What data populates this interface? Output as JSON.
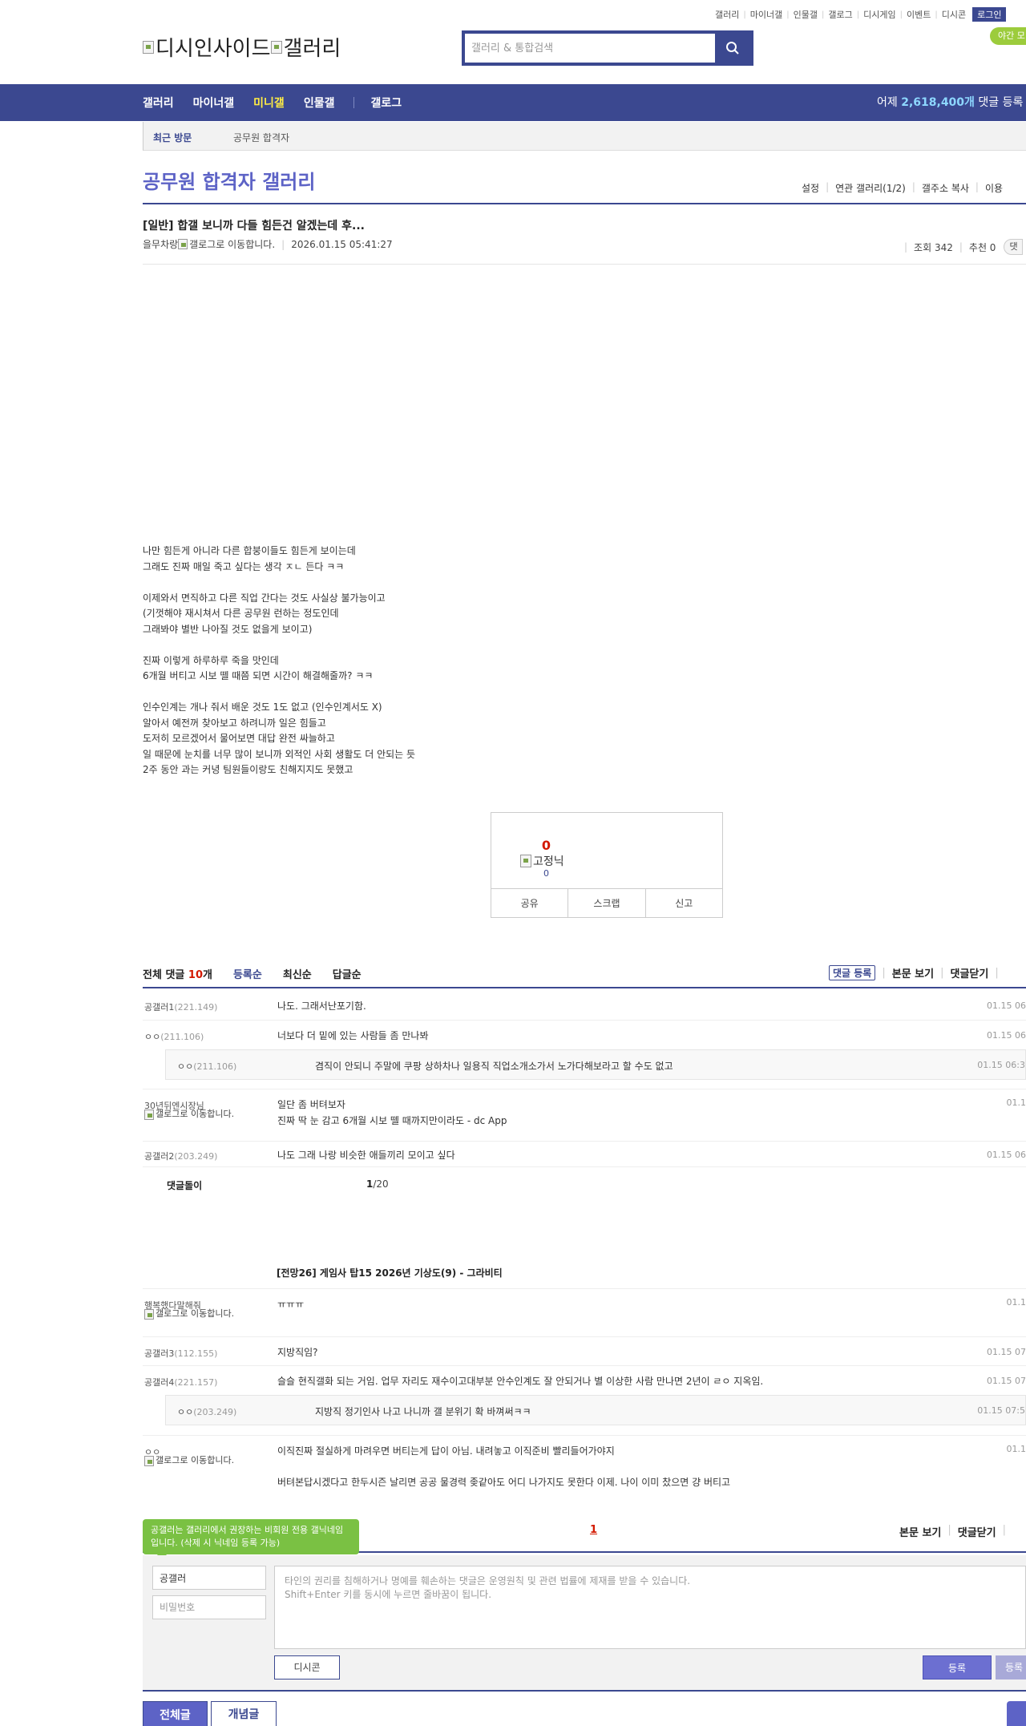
{
  "util_links": [
    "갤러리",
    "마이너갤",
    "인물갤",
    "갤로그",
    "디시게임",
    "이벤트",
    "디시콘"
  ],
  "login_label": "로그인",
  "night_mode_label": "야간 모",
  "logo": {
    "site_alt": "디시인사이드",
    "gallery_alt": "갤러리"
  },
  "search": {
    "placeholder": "갤러리 & 통합검색"
  },
  "gnb": {
    "items": [
      "갤러리",
      "마이너갤",
      "미니갤",
      "인물갤",
      "갤로그"
    ],
    "active_index": 2,
    "stat_prefix": "어제 ",
    "stat_count": "2,618,400개",
    "stat_suffix": " 댓글 등록"
  },
  "recent": {
    "label": "최근 방문",
    "item": "공무원 합격자"
  },
  "gallery": {
    "title": "공무원 합격자 갤러리",
    "tools": [
      "설정",
      "연관 갤러리(1/2)",
      "갤주소 복사",
      "이용"
    ]
  },
  "post": {
    "title": "[일반] 합갤 보니까 다들 힘든건 알겠는데 후...",
    "writer": "을무차랑",
    "gallog_alt": "갤로그로 이동합니다.",
    "date": "2026.01.15 05:41:27",
    "views": "조회 342",
    "recommend": "추천 0",
    "comments_pill": "댓",
    "body": [
      [
        "나만 힘든게 아니라 다른 합붕이들도 힘든게 보이는데",
        "그래도 진짜 매일 죽고 싶다는 생각 ㅈㄴ 든다 ㅋㅋ"
      ],
      [
        "이제와서 면직하고 다른 직업 간다는 것도 사실상 불가능이고",
        "(기껏해야 재시쳐서 다른 공무원 런하는 정도인데",
        "그래봐야 별반 나아질 것도 없을게 보이고)"
      ],
      [
        "진짜 이렇게 하루하루 죽을 맛인데",
        "6개월 버티고 시보 뗄 때쯤 되면 시간이 해결해줄까? ㅋㅋ"
      ],
      [
        "인수인계는 개나 줘서 배운 것도 1도 없고 (인수인계서도 X)",
        "알아서 예전꺼 찾아보고 하려니까 일은 힘들고",
        "도저히 모르겠어서 물어보면 대답 완전 싸늘하고",
        "일 때문에 눈치를 너무 많이 보니까 외적인 사회 생활도 더 안되는 듯",
        "2주 동안 과는 커녕 팀원들이랑도 친해지지도 못했고"
      ]
    ]
  },
  "recommend_box": {
    "count": "0",
    "fixed_alt": "고정닉",
    "fixed_count": "0",
    "buttons": [
      "공유",
      "스크랩",
      "신고"
    ]
  },
  "comments_header": {
    "total_prefix": "전체 댓글 ",
    "total_count": "10",
    "total_suffix": "개",
    "sorts": [
      "등록순",
      "최신순",
      "답글순"
    ],
    "register": "댓글 등록",
    "view_post": "본문 보기",
    "close": "댓글닫기"
  },
  "comments": [
    {
      "nick": "공갤러1",
      "ip": "(221.149)",
      "text": "나도. 그래서난포기함.",
      "date": "01.15 06"
    },
    {
      "nick": "ㅇㅇ",
      "ip": "(211.106)",
      "text": "너보다 더 밑에 있는 사람들 좀 만나봐",
      "date": "01.15 06"
    },
    {
      "nick": "30년뒤엔시장님",
      "gallog": "갤로그로 이동합니다.",
      "text": "일단 좀 버텨보자",
      "text2": "진짜 딱 눈 감고 6개월 시보 뗄 때까지만이라도 - dc App",
      "date": "01.1"
    },
    {
      "nick": "공갤러2",
      "ip": "(203.249)",
      "text": "나도 그래 나랑 비슷한 애들끼리 모이고 싶다",
      "date": "01.15 06"
    }
  ],
  "reply1": {
    "nick": "ㅇㅇ",
    "ip": "(211.106)",
    "text": "겸직이 안되니 주말에 쿠팡 상하차나 일용직 직업소개소가서 노가다해보라고 할 수도 없고",
    "date": "01.15 06:3"
  },
  "bot": {
    "label": "댓글돌이",
    "page_current": "1",
    "page_total": "/20"
  },
  "ad": {
    "title": "[전망26] 게임사 탑15 2026년 기상도(9) - 그라비티"
  },
  "comments2": [
    {
      "nick": "행복했다말해줘",
      "gallog": "갤로그로 이동합니다.",
      "text": "ㅠㅠㅠ",
      "date": "01.1"
    },
    {
      "nick": "공갤러3",
      "ip": "(112.155)",
      "text": "지방직임?",
      "date": "01.15 07"
    },
    {
      "nick": "공갤러4",
      "ip": "(221.157)",
      "text": "슬슬 현직갤화 되는 거임. 업무 자리도 재수이고대부분 안수인계도 잘 안되거나 별 이상한 사람 만나면 2년이 ㄹㅇ 지옥임.",
      "date": "01.15 07"
    },
    {
      "nick": "ㅇㅇ",
      "gallog": "갤로그로 이동합니다.",
      "text": "이직진짜 절실하게 마려우면 버티는게 답이 아님. 내려놓고 이직준비 빨리들어가야지",
      "text2": "버텨본답시겠다고 한두시즌 날리면 공공 물경력 좆같아도 어디 나가지도 못한다 이제. 나이 이미 찼으면 걍 버티고",
      "date": "01.1"
    }
  ],
  "reply2": {
    "nick": "ㅇㅇ",
    "ip": "(203.249)",
    "text": "지방직 정기인사 나고 나니까 갤 분위기 확 바껴써ㅋㅋ",
    "date": "01.15 07:5"
  },
  "comment_footer": {
    "page": "1",
    "view_post": "본문 보기",
    "close": "댓글닫기"
  },
  "tooltip": "공갤러는 갤러리에서 권장하는 비회원 전용 갤닉네임입니다. (삭제 시 닉네임 등록 가능)",
  "write": {
    "nick_value": "공갤러",
    "pw_placeholder": "비밀번호",
    "textarea_placeholder": "타인의 권리를 침해하거나 명예를 훼손하는 댓글은 운영원칙 및 관련 법률에 제재를 받을 수 있습니다.\nShift+Enter 키를 동시에 누르면 줄바꿈이 됩니다.",
    "dccon": "디시콘",
    "register": "등록",
    "register2": "등록"
  },
  "list_buttons": {
    "all": "전체글",
    "concept": "개념글"
  },
  "colors": {
    "brand": "#3b4890",
    "accent": "#5d63c6",
    "highlight": "#ffed44",
    "count_red": "#d31900",
    "tooltip_green": "#7ac143"
  }
}
